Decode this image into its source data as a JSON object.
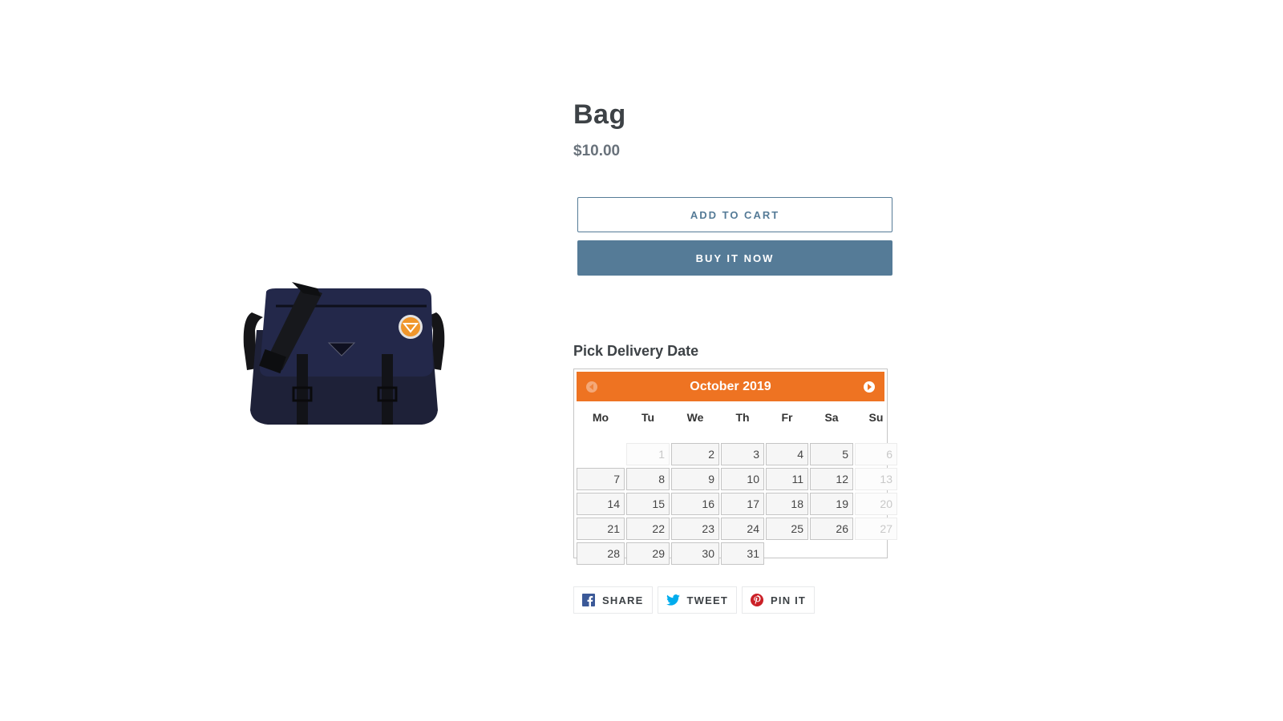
{
  "product": {
    "title": "Bag",
    "price": "$10.00",
    "image_alt": "Navy blue messenger bag with black strap and orange patch"
  },
  "buttons": {
    "add_to_cart": "ADD TO CART",
    "buy_now": "BUY IT NOW"
  },
  "delivery": {
    "label": "Pick Delivery Date",
    "calendar": {
      "month_label": "October 2019",
      "prev_icon": "chevron-left-circle-icon",
      "next_icon": "chevron-right-circle-icon",
      "weekdays": [
        "Mo",
        "Tu",
        "We",
        "Th",
        "Fr",
        "Sa",
        "Su"
      ],
      "weeks": [
        [
          {
            "d": ""
          },
          {
            "d": "1",
            "disabled": true
          },
          {
            "d": "2"
          },
          {
            "d": "3"
          },
          {
            "d": "4"
          },
          {
            "d": "5"
          },
          {
            "d": "6",
            "disabled": true
          }
        ],
        [
          {
            "d": "7"
          },
          {
            "d": "8"
          },
          {
            "d": "9"
          },
          {
            "d": "10"
          },
          {
            "d": "11"
          },
          {
            "d": "12"
          },
          {
            "d": "13",
            "disabled": true
          }
        ],
        [
          {
            "d": "14"
          },
          {
            "d": "15"
          },
          {
            "d": "16"
          },
          {
            "d": "17"
          },
          {
            "d": "18"
          },
          {
            "d": "19"
          },
          {
            "d": "20",
            "disabled": true
          }
        ],
        [
          {
            "d": "21"
          },
          {
            "d": "22"
          },
          {
            "d": "23"
          },
          {
            "d": "24"
          },
          {
            "d": "25"
          },
          {
            "d": "26"
          },
          {
            "d": "27",
            "disabled": true
          }
        ],
        [
          {
            "d": "28"
          },
          {
            "d": "29"
          },
          {
            "d": "30"
          },
          {
            "d": "31"
          },
          {
            "d": ""
          },
          {
            "d": ""
          },
          {
            "d": ""
          }
        ]
      ]
    }
  },
  "share": {
    "facebook": {
      "label": "SHARE",
      "icon": "facebook-icon",
      "color": "#3b5998"
    },
    "twitter": {
      "label": "TWEET",
      "icon": "twitter-icon",
      "color": "#00aced"
    },
    "pinterest": {
      "label": "PIN IT",
      "icon": "pinterest-icon",
      "color": "#cb2027"
    }
  },
  "colors": {
    "accent": "#557b97",
    "calendar_header": "#ee7322"
  }
}
